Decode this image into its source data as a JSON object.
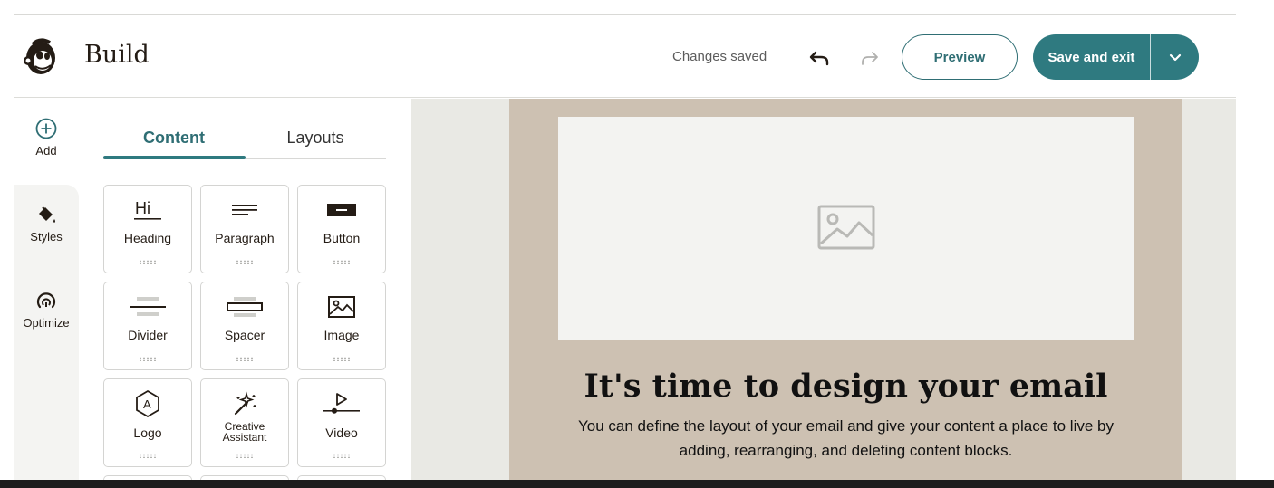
{
  "header": {
    "title": "Build",
    "status": "Changes saved",
    "preview_label": "Preview",
    "save_label": "Save and exit"
  },
  "rail": {
    "items": [
      {
        "label": "Add",
        "icon": "add-circle-icon"
      },
      {
        "label": "Styles",
        "icon": "paint-bucket-icon"
      },
      {
        "label": "Optimize",
        "icon": "gauge-icon"
      }
    ]
  },
  "panel": {
    "tabs": [
      {
        "label": "Content",
        "active": true
      },
      {
        "label": "Layouts",
        "active": false
      }
    ],
    "blocks": [
      {
        "label": "Heading",
        "icon": "heading-icon"
      },
      {
        "label": "Paragraph",
        "icon": "paragraph-icon"
      },
      {
        "label": "Button",
        "icon": "button-icon"
      },
      {
        "label": "Divider",
        "icon": "divider-icon"
      },
      {
        "label": "Spacer",
        "icon": "spacer-icon"
      },
      {
        "label": "Image",
        "icon": "image-icon"
      },
      {
        "label": "Logo",
        "icon": "logo-icon",
        "icon_text": "A"
      },
      {
        "label": "Creative Assistant",
        "label_line1": "Creative",
        "label_line2": "Assistant",
        "icon": "magic-wand-icon"
      },
      {
        "label": "Video",
        "icon": "video-icon"
      }
    ],
    "heading_icon_text": "Hi"
  },
  "email": {
    "headline": "It's time to design your email",
    "body": "You can define the layout of your email and give your content a place to live by adding, rearranging, and deleting content blocks."
  },
  "colors": {
    "accent": "#2f7a80",
    "email_background": "#cdc1b2",
    "canvas_background": "#e9e9e4"
  }
}
